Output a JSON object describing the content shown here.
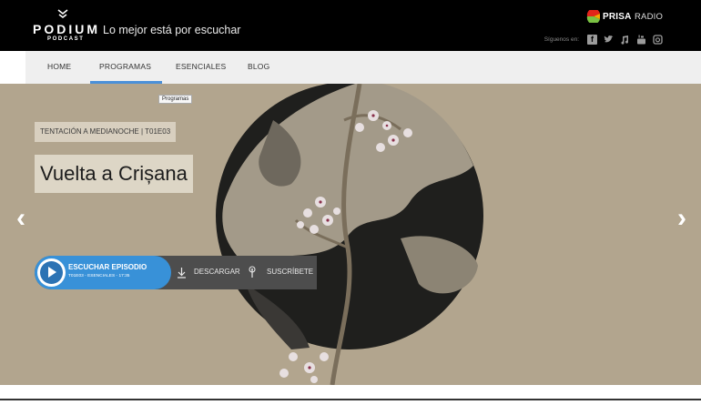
{
  "header": {
    "logo_text": "PODIUM",
    "logo_sub": "PODCAST",
    "tagline": "Lo mejor está por escuchar",
    "prisa_word": "PRISA",
    "prisa_radio": "RADIO",
    "follow_label": "Síguenos en:",
    "social_icons": [
      "facebook-icon",
      "twitter-icon",
      "music-icon",
      "youtube-icon",
      "instagram-icon"
    ]
  },
  "nav": {
    "items": [
      "HOME",
      "PROGRAMAS",
      "ESENCIALES",
      "BLOG"
    ],
    "active_index": 1,
    "tooltip": "Programas"
  },
  "hero": {
    "episode_tag": "TENTACIÓN A MEDIANOCHE | T01E03",
    "title": "Vuelta a Crișana",
    "prev_arrow": "‹",
    "next_arrow": "›"
  },
  "player": {
    "listen_label": "ESCUCHAR EPISODIO",
    "listen_sub": "T01E03 - ESENCIALES - 17:35",
    "download_label": "DESCARGAR",
    "subscribe_label": "SUSCRÍBETE"
  },
  "colors": {
    "accent": "#3891d8",
    "hero_bg": "#b2a58e",
    "nav_active": "#4a90d9"
  }
}
